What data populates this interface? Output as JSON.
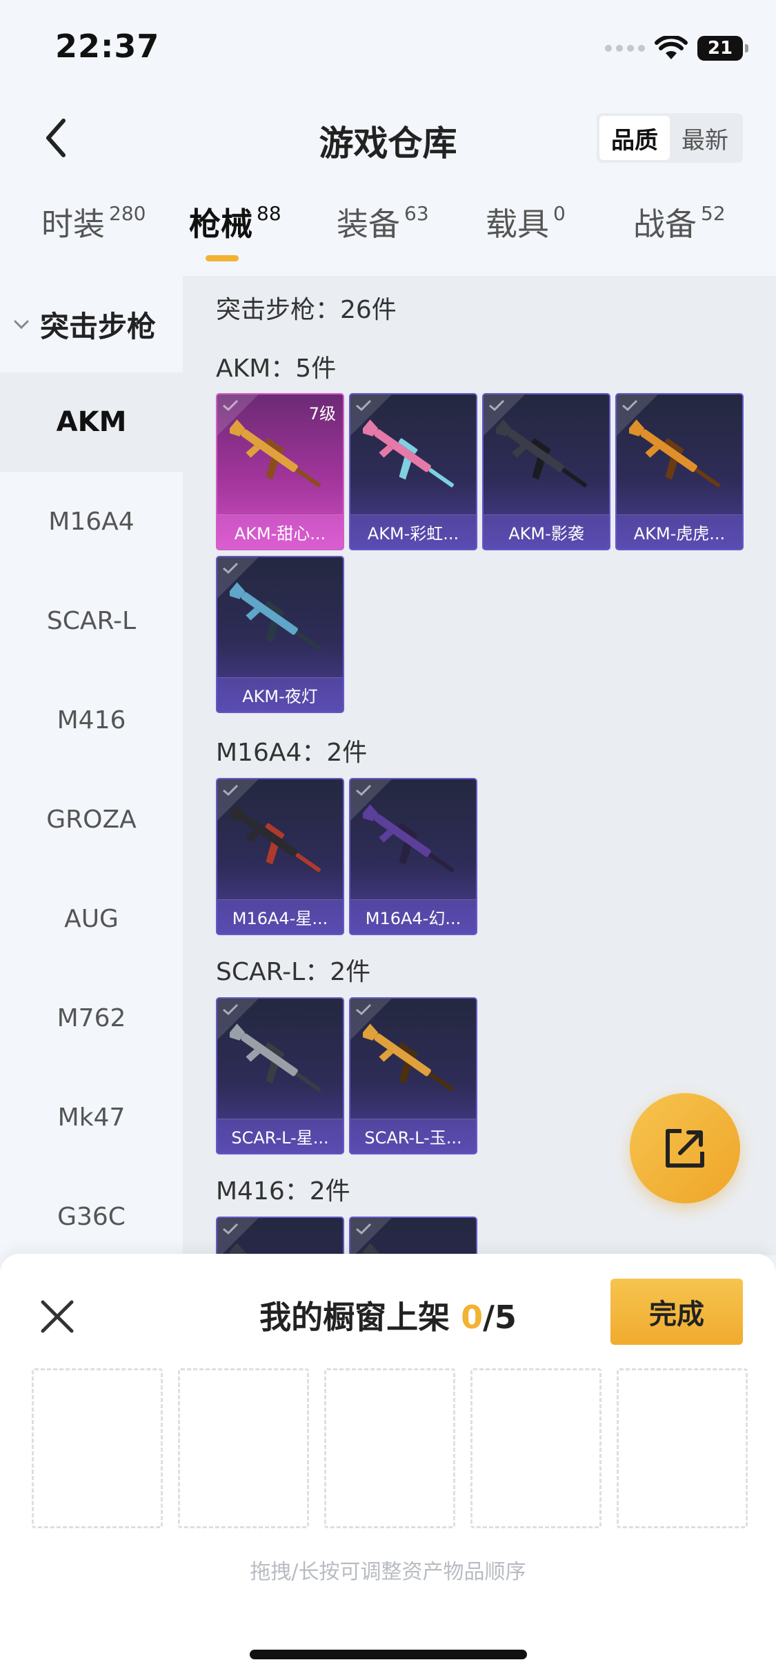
{
  "status_bar": {
    "time": "22:37",
    "battery": "21"
  },
  "header": {
    "title": "游戏仓库",
    "sort_options": [
      {
        "label": "品质",
        "active": true
      },
      {
        "label": "最新",
        "active": false
      }
    ]
  },
  "tabs": [
    {
      "label": "时装",
      "count": "280",
      "active": false
    },
    {
      "label": "枪械",
      "count": "88",
      "active": true
    },
    {
      "label": "装备",
      "count": "63",
      "active": false
    },
    {
      "label": "载具",
      "count": "0",
      "active": false
    },
    {
      "label": "战备",
      "count": "52",
      "active": false
    }
  ],
  "sidebar": {
    "category": "突击步枪",
    "items": [
      "AKM",
      "M16A4",
      "SCAR-L",
      "M416",
      "GROZA",
      "AUG",
      "M762",
      "Mk47",
      "G36C"
    ],
    "active_index": 0
  },
  "content": {
    "summary": "突击步枪：26件",
    "sections": [
      {
        "title": "AKM：5件",
        "items": [
          {
            "name": "AKM-甜心...",
            "level": "7级",
            "rarity": "legendary"
          },
          {
            "name": "AKM-彩虹...",
            "rarity": "epic"
          },
          {
            "name": "AKM-影袭",
            "rarity": "epic"
          },
          {
            "name": "AKM-虎虎...",
            "rarity": "epic"
          },
          {
            "name": "AKM-夜灯",
            "rarity": "epic"
          }
        ]
      },
      {
        "title": "M16A4：2件",
        "items": [
          {
            "name": "M16A4-星...",
            "rarity": "epic"
          },
          {
            "name": "M16A4-幻...",
            "rarity": "epic"
          }
        ]
      },
      {
        "title": "SCAR-L：2件",
        "items": [
          {
            "name": "SCAR-L-星...",
            "rarity": "epic"
          },
          {
            "name": "SCAR-L-玉...",
            "rarity": "epic"
          }
        ]
      },
      {
        "title": "M416：2件",
        "items": []
      }
    ]
  },
  "bottom_sheet": {
    "title": "我的橱窗上架 ",
    "count_current": "0",
    "count_total": "/5",
    "done_label": "完成",
    "hint": "拖拽/长按可调整资产物品顺序"
  },
  "colors": {
    "accent": "#f2b233",
    "card_epic": "#4c3f98",
    "card_legendary": "#cf4fc2"
  },
  "icons": [
    "back-arrow-icon",
    "wifi-icon",
    "battery-icon",
    "chevron-down-icon",
    "share-icon",
    "close-icon",
    "check-icon",
    "rifle-icon"
  ]
}
